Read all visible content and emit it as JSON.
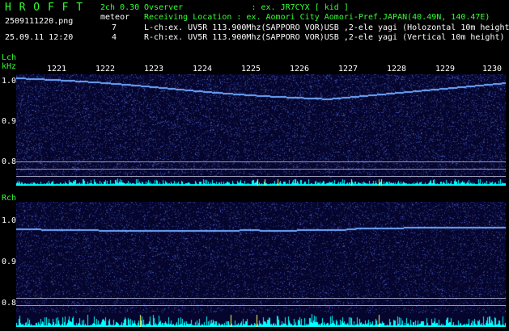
{
  "header": {
    "app_title": "H R O F F T",
    "version": "2ch 0.30",
    "filename": "2509111220.png",
    "meteor_label": "meteor",
    "l_count": "7",
    "r_count": "4",
    "datetime": "25.09.11 12:20",
    "observer_line": "Ovserver              : ex. JR7CYX [ kid ]",
    "location_line": "Receiving Location : ex. Aomori City Aomori-Pref.JAPAN(40.49N, 140.47E)",
    "lch_line": "L-ch:ex. UV5R 113.900Mhz(SAPPORO VOR)USB ,2-ele yagi (Holozontal 10m height)",
    "rch_line": "R-ch:ex. UV5R 113.900Mhz(SAPPORO VOR)USB ,2-ele yagi (Vertical 10m height)"
  },
  "lch": {
    "channel_label": "Lch",
    "unit_label": "kHz",
    "time_ticks": [
      "1221",
      "1222",
      "1223",
      "1224",
      "1225",
      "1226",
      "1227",
      "1228",
      "1229",
      "1230"
    ],
    "freq_ticks": [
      "1.0",
      "0.9",
      "0.8"
    ]
  },
  "rch": {
    "channel_label": "Rch",
    "freq_ticks": [
      "1.0",
      "0.9",
      "0.8"
    ]
  },
  "colors": {
    "header_green": "#33ff33",
    "panel_bg": "#05052e",
    "trace": "#6ea8ff",
    "level_bars": "#00ffff",
    "meteor_marks": "#ffff66"
  }
}
